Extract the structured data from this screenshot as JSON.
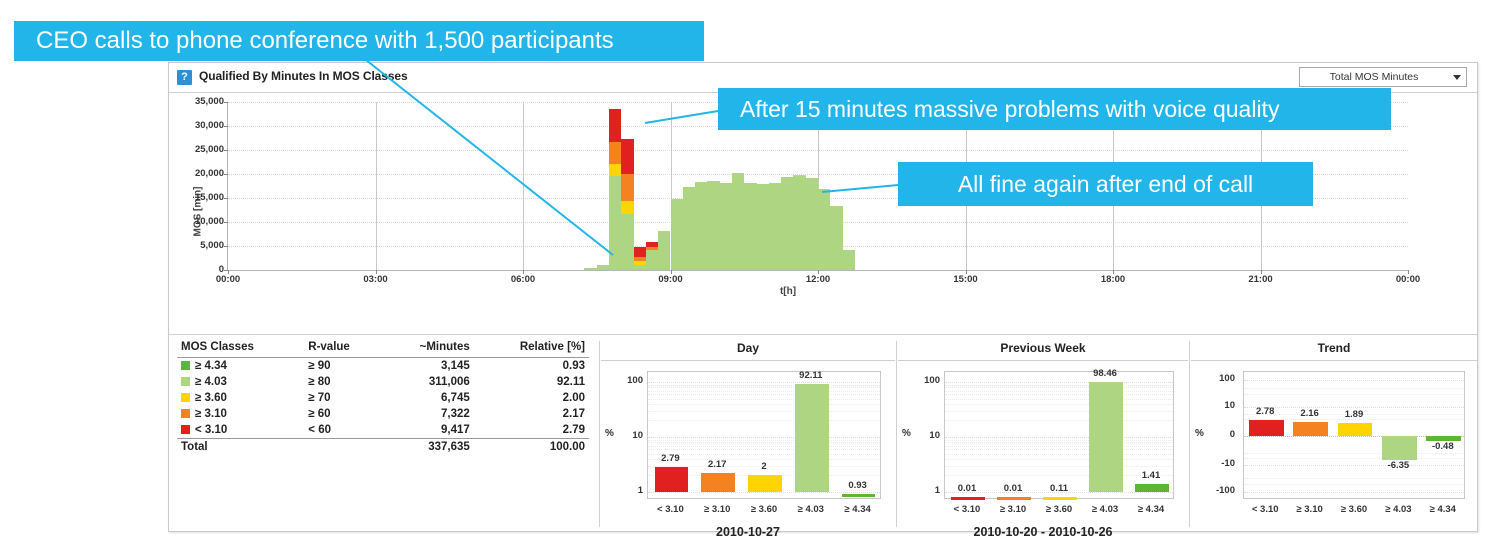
{
  "panel": {
    "help_icon": "question-mark-icon",
    "title": "Qualified By Minutes In MOS Classes",
    "selector": {
      "value": "Total MOS Minutes",
      "arrow": "chevron-down-icon"
    }
  },
  "annotations": [
    {
      "id": "callout-1",
      "text": "CEO calls to phone conference with 1,500 participants"
    },
    {
      "id": "callout-2",
      "text": "After 15 minutes massive  problems with voice quality"
    },
    {
      "id": "callout-3",
      "text": "All fine again after end of call"
    }
  ],
  "colors": {
    "callout": "#22b5ea",
    "class_ge_434": "#5fb534",
    "class_ge_403": "#aed581",
    "class_ge_360": "#ffd400",
    "class_ge_310": "#f58220",
    "class_lt_310": "#e0211f"
  },
  "table": {
    "headers": [
      "MOS Classes",
      "R-value",
      "~Minutes",
      "Relative [%]"
    ],
    "rows": [
      {
        "color": "#5fb534",
        "mos_class": "≥ 4.34",
        "r_value": "≥ 90",
        "minutes": "3,145",
        "relative": "0.93"
      },
      {
        "color": "#aed581",
        "mos_class": "≥ 4.03",
        "r_value": "≥ 80",
        "minutes": "311,006",
        "relative": "92.11"
      },
      {
        "color": "#ffd400",
        "mos_class": "≥ 3.60",
        "r_value": "≥ 70",
        "minutes": "6,745",
        "relative": "2.00"
      },
      {
        "color": "#f58220",
        "mos_class": "≥ 3.10",
        "r_value": "≥ 60",
        "minutes": "7,322",
        "relative": "2.17"
      },
      {
        "color": "#e0211f",
        "mos_class": "< 3.10",
        "r_value": "< 60",
        "minutes": "9,417",
        "relative": "2.79"
      }
    ],
    "total": {
      "label": "Total",
      "minutes": "337,635",
      "relative": "100.00"
    }
  },
  "chart_data": [
    {
      "type": "bar",
      "name": "qualified-by-minutes-in-mos-classes",
      "title": "Qualified By Minutes In MOS Classes",
      "stacked": true,
      "xlabel": "t[h]",
      "ylabel": "MOS [min]",
      "ylim": [
        0,
        35000
      ],
      "yticks": [
        "0",
        "5,000",
        "10,000",
        "15,000",
        "20,000",
        "25,000",
        "30,000",
        "35,000"
      ],
      "xticks": [
        "00:00",
        "03:00",
        "06:00",
        "09:00",
        "12:00",
        "15:00",
        "18:00",
        "21:00",
        "00:00"
      ],
      "grid": true,
      "bin_minutes": 15,
      "series": [
        {
          "name": "≥ 4.03",
          "color": "#aed581"
        },
        {
          "name": "≥ 3.60",
          "color": "#ffd400"
        },
        {
          "name": "≥ 3.10",
          "color": "#f58220"
        },
        {
          "name": "< 3.10",
          "color": "#e0211f"
        }
      ],
      "bars": [
        {
          "t": "07:15",
          "green": 500,
          "yellow": 0,
          "orange": 0,
          "red": 0
        },
        {
          "t": "07:30",
          "green": 1100,
          "yellow": 0,
          "orange": 0,
          "red": 0
        },
        {
          "t": "07:45",
          "green": 19500,
          "yellow": 2600,
          "orange": 4600,
          "red": 6900
        },
        {
          "t": "08:00",
          "green": 11600,
          "yellow": 2700,
          "orange": 5800,
          "red": 7100
        },
        {
          "t": "08:15",
          "green": 1000,
          "yellow": 900,
          "orange": 900,
          "red": 2000
        },
        {
          "t": "08:30",
          "green": 4200,
          "yellow": 0,
          "orange": 500,
          "red": 1100
        },
        {
          "t": "08:45",
          "green": 8200,
          "yellow": 0,
          "orange": 0,
          "red": 0
        },
        {
          "t": "09:00",
          "green": 14800,
          "yellow": 0,
          "orange": 0,
          "red": 0
        },
        {
          "t": "09:15",
          "green": 17200,
          "yellow": 0,
          "orange": 0,
          "red": 0
        },
        {
          "t": "09:30",
          "green": 18400,
          "yellow": 0,
          "orange": 0,
          "red": 0
        },
        {
          "t": "09:45",
          "green": 18600,
          "yellow": 0,
          "orange": 0,
          "red": 0
        },
        {
          "t": "10:00",
          "green": 18100,
          "yellow": 0,
          "orange": 0,
          "red": 0
        },
        {
          "t": "10:15",
          "green": 20300,
          "yellow": 0,
          "orange": 0,
          "red": 0
        },
        {
          "t": "10:30",
          "green": 18200,
          "yellow": 0,
          "orange": 0,
          "red": 0
        },
        {
          "t": "10:45",
          "green": 17900,
          "yellow": 0,
          "orange": 0,
          "red": 0
        },
        {
          "t": "11:00",
          "green": 18200,
          "yellow": 0,
          "orange": 0,
          "red": 0
        },
        {
          "t": "11:15",
          "green": 19400,
          "yellow": 0,
          "orange": 0,
          "red": 0
        },
        {
          "t": "11:30",
          "green": 19600,
          "yellow": 150,
          "orange": 0,
          "red": 0
        },
        {
          "t": "11:45",
          "green": 19100,
          "yellow": 0,
          "orange": 0,
          "red": 0
        },
        {
          "t": "12:00",
          "green": 16800,
          "yellow": 0,
          "orange": 0,
          "red": 0
        },
        {
          "t": "12:15",
          "green": 13400,
          "yellow": 0,
          "orange": 0,
          "red": 0
        },
        {
          "t": "12:30",
          "green": 4200,
          "yellow": 0,
          "orange": 0,
          "red": 0
        }
      ]
    },
    {
      "type": "bar",
      "name": "day-distribution",
      "title": "Day",
      "subtitle": "2010-10-27",
      "ylabel": "%",
      "scale": "log",
      "yticks": [
        "1",
        "10",
        "100"
      ],
      "categories": [
        "< 3.10",
        "≥ 3.10",
        "≥ 3.60",
        "≥ 4.03",
        "≥ 4.34"
      ],
      "values": [
        2.79,
        2.17,
        2,
        92.11,
        0.93
      ],
      "labels": [
        "2.79",
        "2.17",
        "2",
        "92.11",
        "0.93"
      ],
      "bar_colors": [
        "#e0211f",
        "#f58220",
        "#ffd400",
        "#aed581",
        "#5fb534"
      ]
    },
    {
      "type": "bar",
      "name": "previous-week-distribution",
      "title": "Previous Week",
      "subtitle": "2010-10-20 - 2010-10-26",
      "ylabel": "%",
      "scale": "log",
      "yticks": [
        "1",
        "10",
        "100"
      ],
      "categories": [
        "< 3.10",
        "≥ 3.10",
        "≥ 3.60",
        "≥ 4.03",
        "≥ 4.34"
      ],
      "values": [
        0.01,
        0.01,
        0.11,
        98.46,
        1.41
      ],
      "labels": [
        "0.01",
        "0.01",
        "0.11",
        "98.46",
        "1.41"
      ],
      "bar_colors": [
        "#e0211f",
        "#f58220",
        "#ffd400",
        "#aed581",
        "#5fb534"
      ]
    },
    {
      "type": "bar",
      "name": "trend-distribution",
      "title": "Trend",
      "ylabel": "%",
      "scale": "symlog",
      "yticks": [
        "100",
        "10",
        "0",
        "-10",
        "-100"
      ],
      "categories": [
        "< 3.10",
        "≥ 3.10",
        "≥ 3.60",
        "≥ 4.03",
        "≥ 4.34"
      ],
      "values": [
        2.78,
        2.16,
        1.89,
        -6.35,
        -0.48
      ],
      "labels": [
        "2.78",
        "2.16",
        "1.89",
        "-6.35",
        "-0.48"
      ],
      "bar_colors": [
        "#e0211f",
        "#f58220",
        "#ffd400",
        "#aed581",
        "#5fb534"
      ]
    }
  ]
}
